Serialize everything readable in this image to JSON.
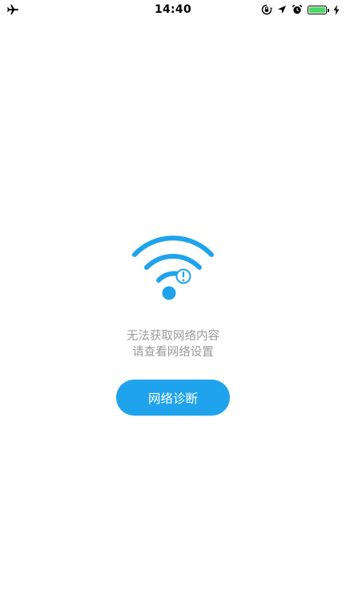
{
  "status_bar": {
    "time": "14:40",
    "airplane_icon": "airplane-icon",
    "battery_level": 1.0,
    "battery_color": "#4cd964"
  },
  "empty_state": {
    "icon": "wifi-alert-icon",
    "accent_color": "#1fa3ec",
    "line1": "无法获取网络内容",
    "line2": "请查看网络设置"
  },
  "actions": {
    "diagnose_label": "网络诊断"
  }
}
